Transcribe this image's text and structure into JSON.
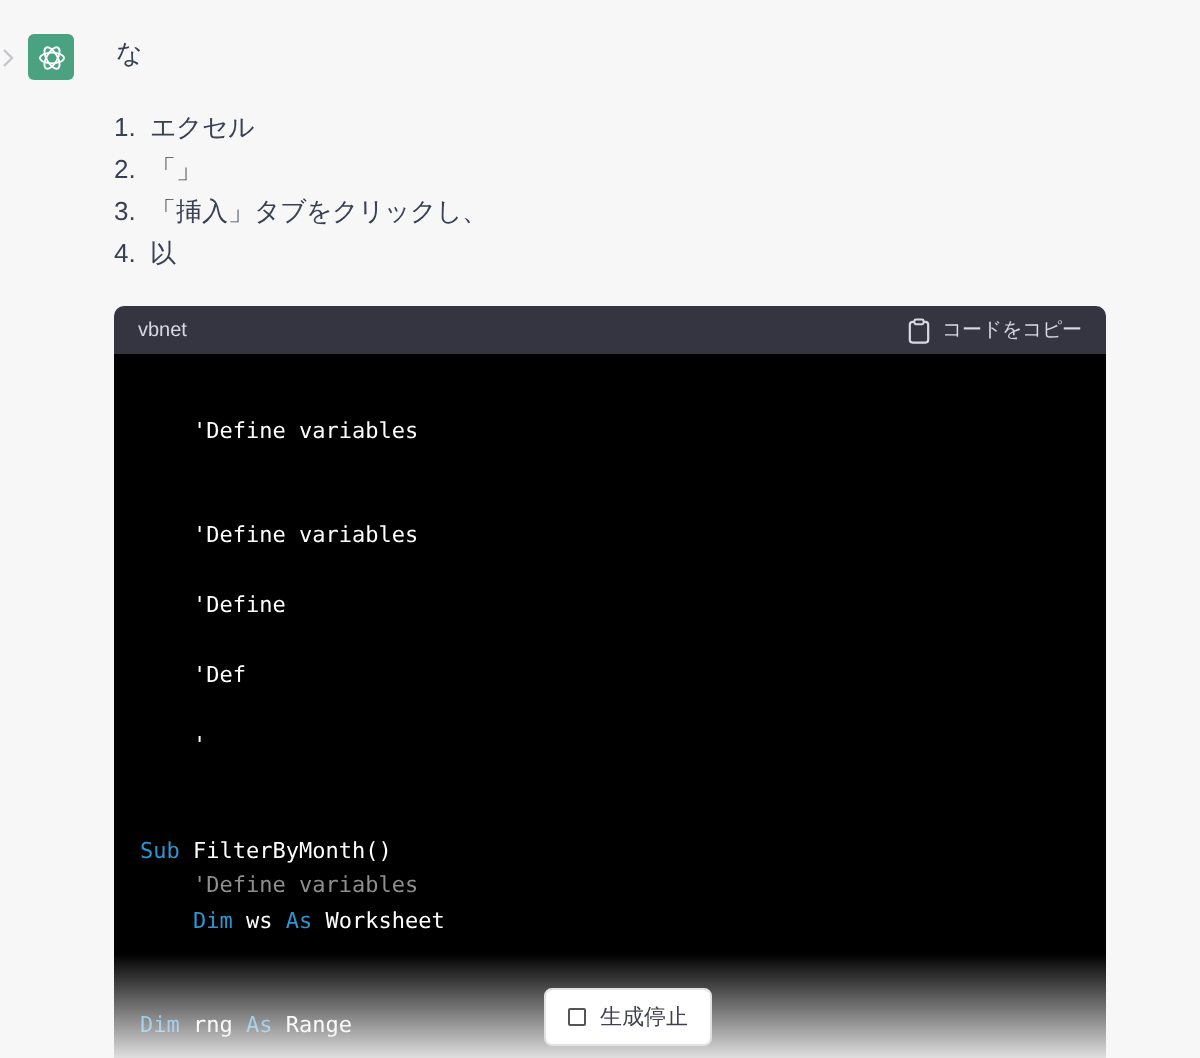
{
  "message": {
    "text": "な",
    "list": [
      {
        "number": "1.",
        "text": "エクセル"
      },
      {
        "number": "2.",
        "text": "「」"
      },
      {
        "number": "3.",
        "text": "「挿入」タブをクリックし、"
      },
      {
        "number": "4.",
        "text": "以"
      }
    ],
    "code_block": {
      "language": "vbnet",
      "copy_label": "コードをコピー",
      "lines": [
        {
          "kind": "blank"
        },
        {
          "kind": "code",
          "tokens": [
            {
              "kind": "plain",
              "text": "    'Define variables"
            }
          ]
        },
        {
          "kind": "blank"
        },
        {
          "kind": "blank"
        },
        {
          "kind": "code",
          "tokens": [
            {
              "kind": "plain",
              "text": "    'Define variables"
            }
          ]
        },
        {
          "kind": "blank"
        },
        {
          "kind": "code",
          "tokens": [
            {
              "kind": "plain",
              "text": "    'Define"
            }
          ]
        },
        {
          "kind": "blank"
        },
        {
          "kind": "code",
          "tokens": [
            {
              "kind": "plain",
              "text": "    'Def"
            }
          ]
        },
        {
          "kind": "blank"
        },
        {
          "kind": "code",
          "tokens": [
            {
              "kind": "plain",
              "text": "    '"
            }
          ]
        },
        {
          "kind": "blank"
        },
        {
          "kind": "blank"
        },
        {
          "kind": "code",
          "tokens": [
            {
              "kind": "keyword",
              "text": "Sub"
            },
            {
              "kind": "plain",
              "text": " FilterByMonth()"
            }
          ]
        },
        {
          "kind": "code",
          "tokens": [
            {
              "kind": "comment",
              "text": "    'Define variables"
            }
          ]
        },
        {
          "kind": "code",
          "tokens": [
            {
              "kind": "keyword",
              "text": "    Dim"
            },
            {
              "kind": "plain",
              "text": " ws "
            },
            {
              "kind": "keyword",
              "text": "As"
            },
            {
              "kind": "plain",
              "text": " Worksheet"
            }
          ]
        },
        {
          "kind": "blank"
        },
        {
          "kind": "blank"
        },
        {
          "kind": "code",
          "tokens": [
            {
              "kind": "keyword",
              "text": "Dim"
            },
            {
              "kind": "plain",
              "text": " rng "
            },
            {
              "kind": "keyword",
              "text": "As"
            },
            {
              "kind": "plain",
              "text": " Range"
            }
          ]
        }
      ]
    }
  },
  "stop_button": {
    "label": "生成停止"
  }
}
